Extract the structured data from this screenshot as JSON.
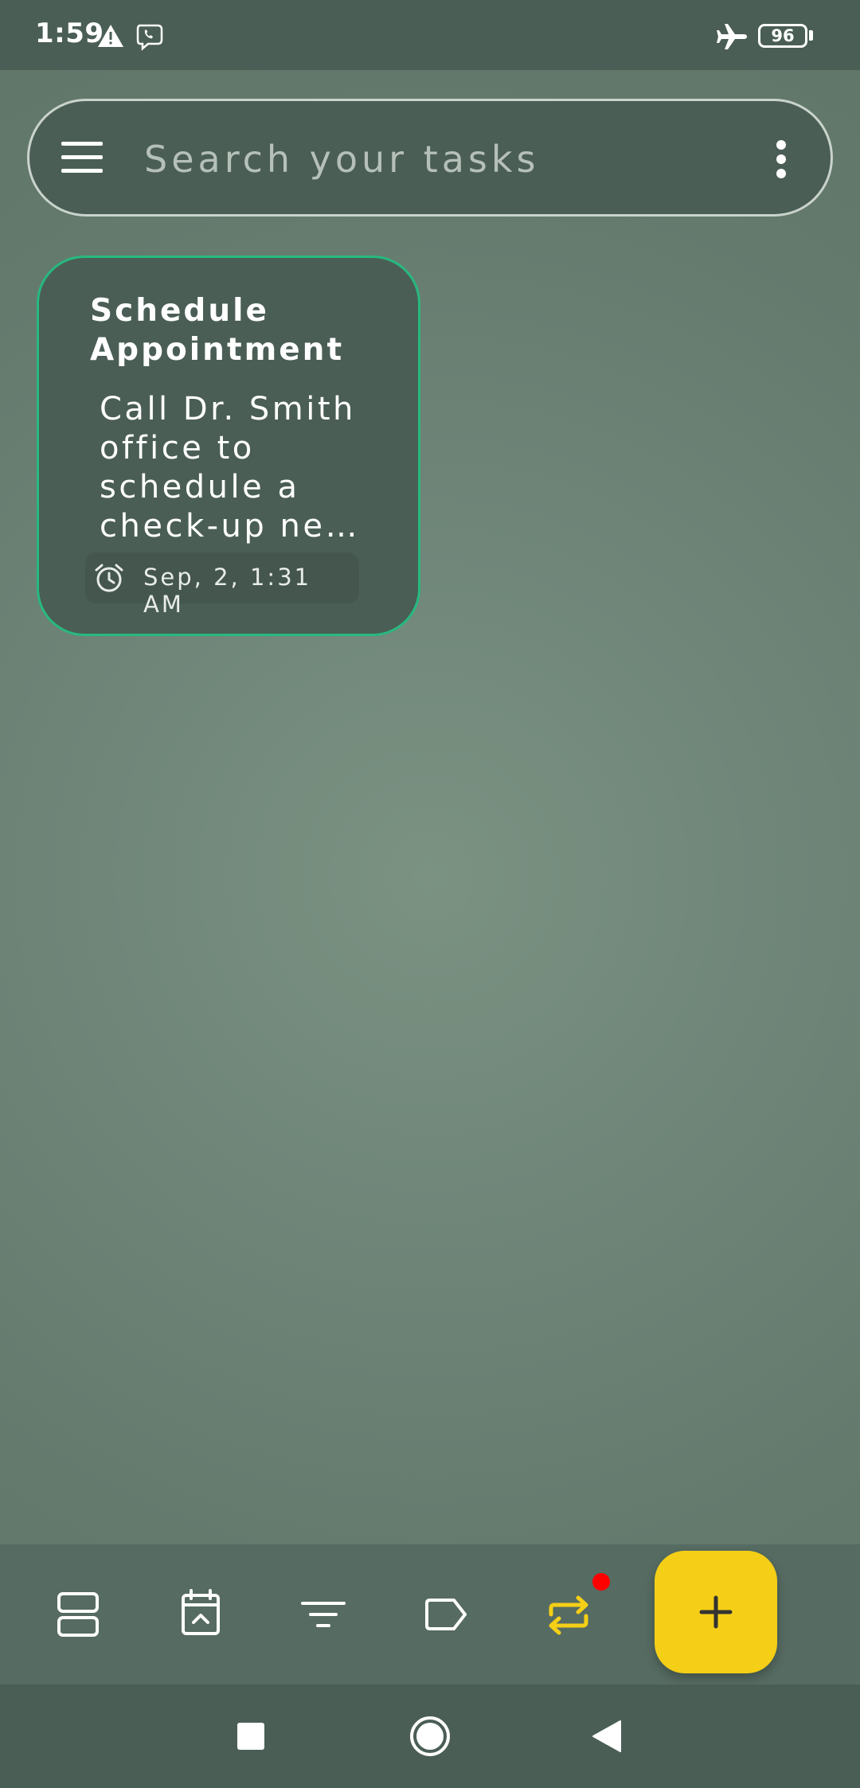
{
  "status_bar": {
    "time": "1:59",
    "icons": [
      "warning-icon",
      "viber-icon",
      "airplane-icon"
    ],
    "battery_level": "96"
  },
  "search": {
    "placeholder": "Search your tasks",
    "left_icon": "menu-icon",
    "right_icon": "more-vert-icon"
  },
  "tasks": [
    {
      "title": "Schedule Appointment",
      "body": "Call Dr. Smith office to schedule a check-up ne…",
      "reminder": "Sep, 2, 1:31 AM",
      "reminder_icon": "alarm-icon",
      "accent_color": "#27b97f"
    }
  ],
  "bottom_bar": {
    "items": [
      {
        "icon": "view-agenda-icon"
      },
      {
        "icon": "calendar-icon"
      },
      {
        "icon": "filter-icon"
      },
      {
        "icon": "label-icon"
      },
      {
        "icon": "repeat-icon",
        "color": "#f5cf17",
        "has_notification": true
      }
    ],
    "fab_icon": "add-icon",
    "fab_color": "#f5cf17",
    "notification_color": "#ff0000"
  },
  "nav_bar": {
    "items": [
      "recents-icon",
      "home-icon",
      "back-icon"
    ]
  },
  "colors": {
    "surface": "#4a5e55",
    "background": "#70877a",
    "accent": "#27b97f",
    "fab": "#f5cf17"
  }
}
